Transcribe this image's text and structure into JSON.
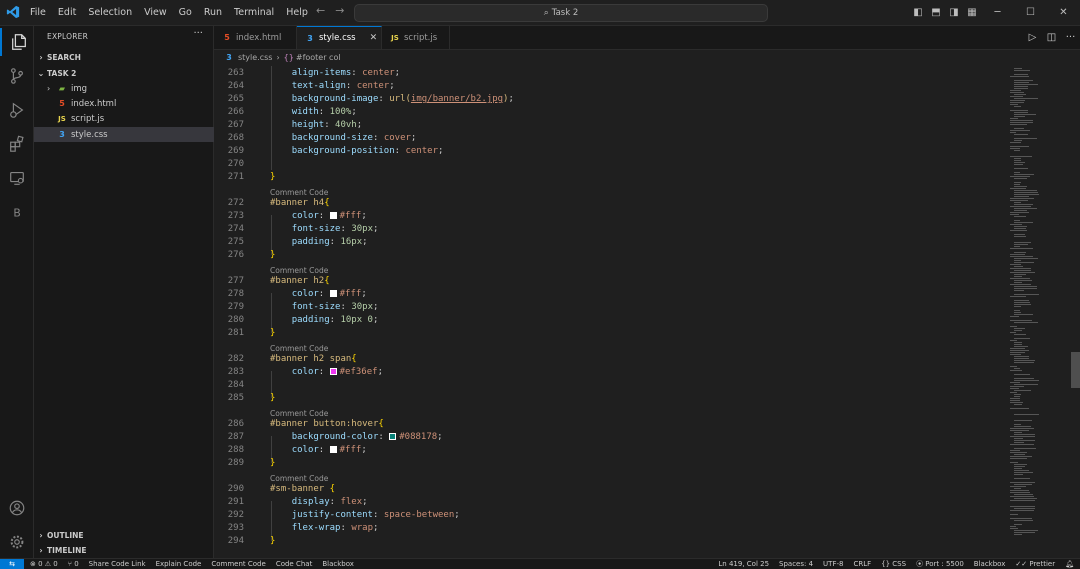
{
  "menu": [
    "File",
    "Edit",
    "Selection",
    "View",
    "Go",
    "Run",
    "Terminal",
    "Help"
  ],
  "command_center": "Task 2",
  "colors": {
    "accent": "#0078d4",
    "white_swatch": "#ffffff",
    "magenta_swatch": "#ef36ef",
    "teal_swatch": "#088178"
  },
  "sidebar": {
    "title": "EXPLORER",
    "search_label": "SEARCH",
    "folder_label": "TASK 2",
    "items": [
      "img",
      "index.html",
      "script.js",
      "style.css"
    ],
    "outline_label": "OUTLINE",
    "timeline_label": "TIMELINE"
  },
  "tabs": [
    "index.html",
    "style.css",
    "script.js"
  ],
  "breadcrumb": {
    "file": "style.css",
    "symbol": "#footer col"
  },
  "editor": {
    "lens": "Comment Code",
    "lines": {
      "263": "    align-items: center;",
      "264": "    text-align: center;",
      "265": "    background-image: url(img/banner/b2.jpg);",
      "266": "    width: 100%;",
      "267": "    height: 40vh;",
      "268": "    background-size: cover;",
      "269": "    background-position: center;",
      "270": "",
      "271": "}",
      "272": "#banner h4{",
      "273": "    color: #fff;",
      "274": "    font-size: 30px;",
      "275": "    padding: 16px;",
      "276": "}",
      "277": "#banner h2{",
      "278": "    color: #fff;",
      "279": "    font-size: 30px;",
      "280": "    padding: 10px 0;",
      "281": "}",
      "282": "#banner h2 span{",
      "283": "    color: #ef36ef;",
      "284": "",
      "285": "}",
      "286": "#banner button:hover{",
      "287": "    background-color: #088178;",
      "288": "    color: #fff;",
      "289": "}",
      "290": "#sm-banner {",
      "291": "    display: flex;",
      "292": "    justify-content: space-between;",
      "293": "    flex-wrap: wrap;",
      "294": "}"
    }
  },
  "statusbar": {
    "errors": "0",
    "warnings": "0",
    "ports": "0",
    "left_items": [
      "Share Code Link",
      "Explain Code",
      "Comment Code",
      "Code Chat",
      "Blackbox"
    ],
    "position": "Ln 419, Col 25",
    "spaces": "Spaces: 4",
    "encoding": "UTF-8",
    "eol": "CRLF",
    "language": "CSS",
    "port": "Port : 5500",
    "blackbox": "Blackbox",
    "prettier": "Prettier"
  }
}
